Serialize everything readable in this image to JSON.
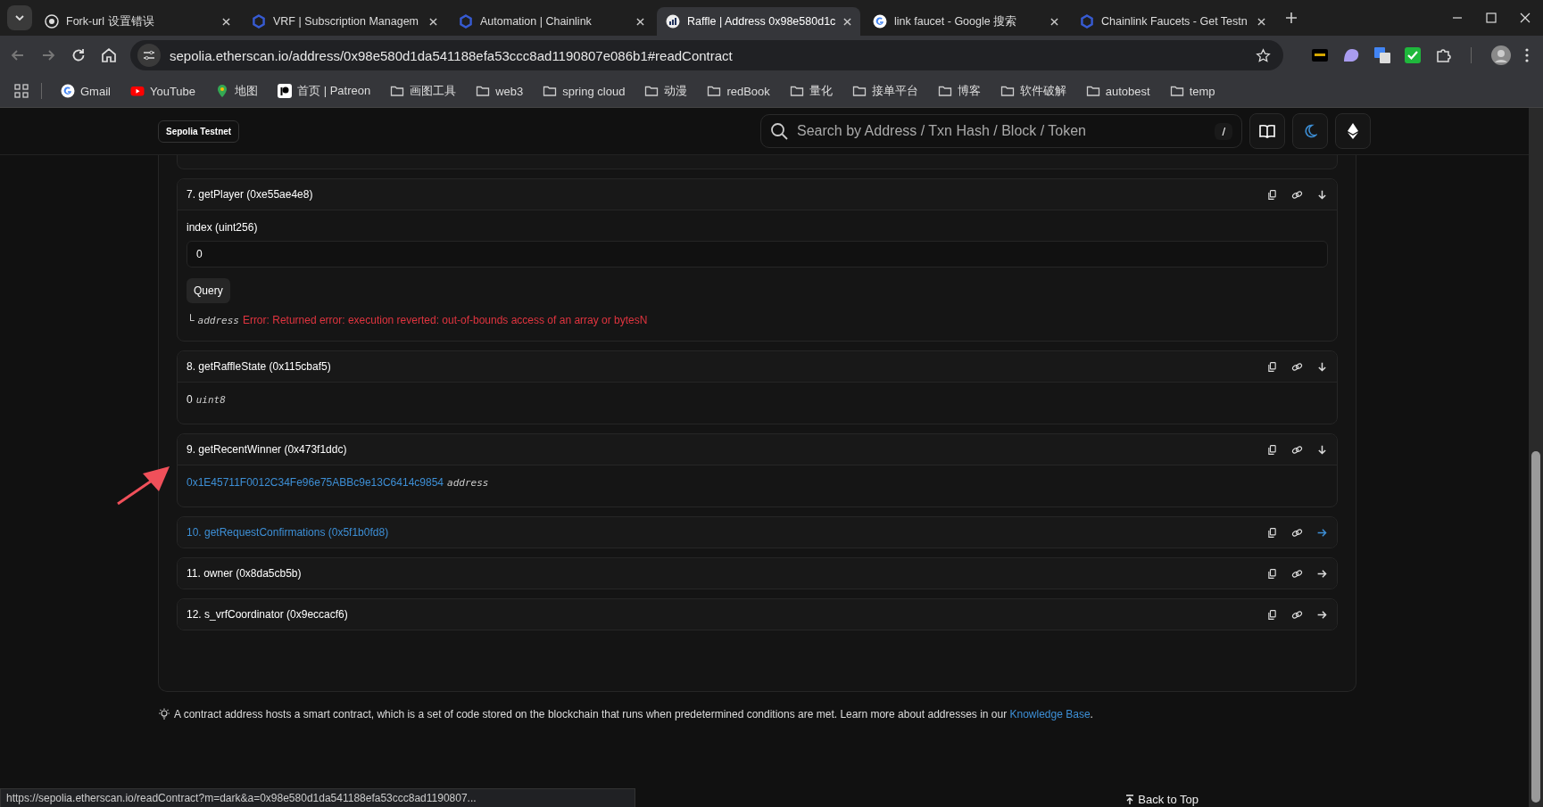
{
  "browser": {
    "tabs": [
      {
        "title": "Fork-url 设置错误",
        "kind": "globe",
        "selected": false
      },
      {
        "title": "VRF | Subscription Managem",
        "kind": "hexagon",
        "selected": false
      },
      {
        "title": "Automation | Chainlink",
        "kind": "hexagon",
        "selected": false
      },
      {
        "title": "Raffle | Address 0x98e580d1c",
        "kind": "chart",
        "selected": true
      },
      {
        "title": "link faucet - Google 搜索",
        "kind": "google",
        "selected": false
      },
      {
        "title": "Chainlink Faucets - Get Testn",
        "kind": "hexagon",
        "selected": false
      }
    ],
    "url": "sepolia.etherscan.io/address/0x98e580d1da541188efa53ccc8ad1190807e086b1#readContract",
    "bookmarks": [
      {
        "label": "Gmail",
        "kind": "google"
      },
      {
        "label": "YouTube",
        "kind": "youtube"
      },
      {
        "label": "地图",
        "kind": "pin"
      },
      {
        "label": "首页 | Patreon",
        "kind": "patreon"
      },
      {
        "label": "画图工具",
        "kind": "folder"
      },
      {
        "label": "web3",
        "kind": "folder"
      },
      {
        "label": "spring cloud",
        "kind": "folder"
      },
      {
        "label": "动漫",
        "kind": "folder"
      },
      {
        "label": "redBook",
        "kind": "folder"
      },
      {
        "label": "量化",
        "kind": "folder"
      },
      {
        "label": "接单平台",
        "kind": "folder"
      },
      {
        "label": "博客",
        "kind": "folder"
      },
      {
        "label": "软件破解",
        "kind": "folder"
      },
      {
        "label": "autobest",
        "kind": "folder"
      },
      {
        "label": "temp",
        "kind": "folder"
      }
    ],
    "status_url": "https://sepolia.etherscan.io/readContract?m=dark&a=0x98e580d1da541188efa53ccc8ad1190807..."
  },
  "header": {
    "network": "Sepolia Testnet",
    "search_placeholder": "Search by Address / Txn Hash / Block / Token",
    "shortcut": "/"
  },
  "functions": [
    {
      "title": "7. getPlayer (0xe55ae4e8)",
      "expanded": true,
      "hovered": false,
      "inputs": [
        {
          "label": "index (uint256)",
          "value": "0"
        }
      ],
      "button": "Query",
      "result": {
        "kind": "error",
        "prefix": "└",
        "type": "address",
        "text": "Error: Returned error: execution reverted: out-of-bounds access of an array or bytesN"
      }
    },
    {
      "title": "8. getRaffleState (0x115cbaf5)",
      "expanded": true,
      "hovered": false,
      "result": {
        "kind": "plain",
        "text": "0",
        "type": "uint8"
      }
    },
    {
      "title": "9. getRecentWinner (0x473f1ddc)",
      "expanded": true,
      "hovered": false,
      "result": {
        "kind": "link",
        "text": "0x1E45711F0012C34Fe96e75ABBc9e13C6414c9854",
        "type": "address"
      }
    },
    {
      "title": "10. getRequestConfirmations (0x5f1b0fd8)",
      "expanded": false,
      "hovered": true
    },
    {
      "title": "11. owner (0x8da5cb5b)",
      "expanded": false,
      "hovered": false
    },
    {
      "title": "12. s_vrfCoordinator (0x9eccacf6)",
      "expanded": false,
      "hovered": false
    }
  ],
  "note": {
    "text": "A contract address hosts a smart contract, which is a set of code stored on the blockchain that runs when predetermined conditions are met. Learn more about addresses in our ",
    "link": "Knowledge Base",
    "after": "."
  },
  "back_to_top": "Back to Top"
}
